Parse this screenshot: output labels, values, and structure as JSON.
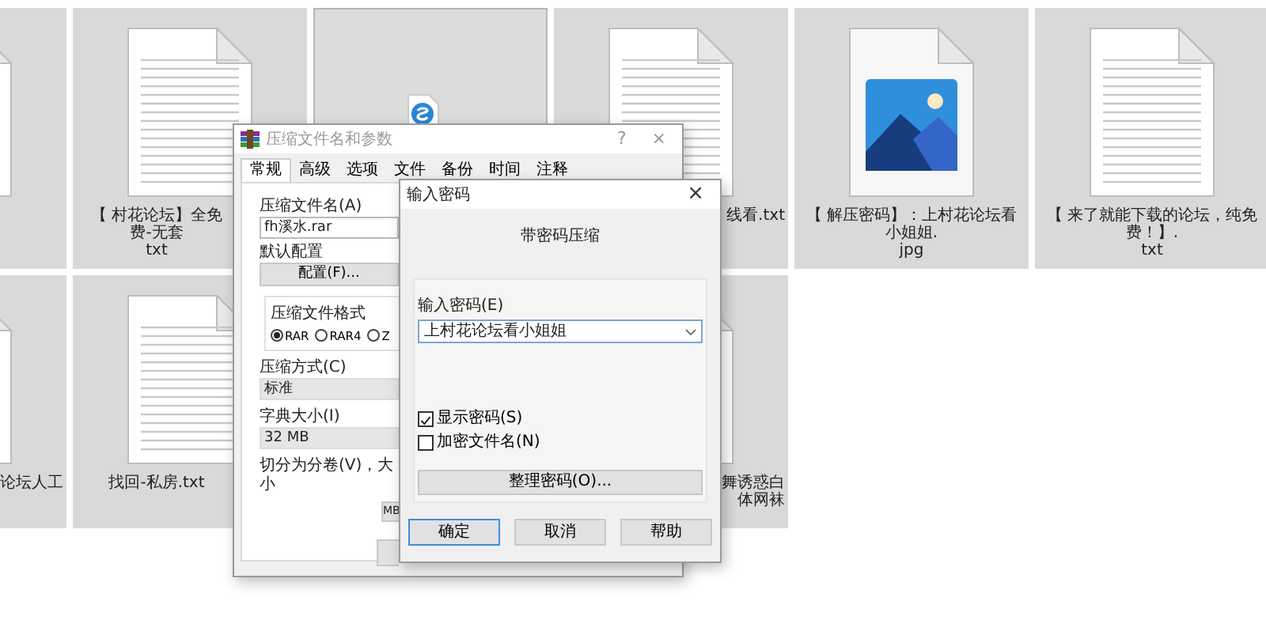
{
  "file_grid": {
    "rows": [
      {
        "tiles": [
          {
            "kind": "text",
            "selected": false
          },
          {
            "kind": "text",
            "selected": false,
            "lines": [
              "【 村花论坛】全免费-无套",
              "txt"
            ]
          },
          {
            "kind": "app",
            "selected": true
          },
          {
            "kind": "text",
            "selected": false,
            "lines": [
              "线看.txt"
            ]
          },
          {
            "kind": "image",
            "selected": false,
            "lines": [
              "【 解压密码】：上村花论坛看小姐姐.",
              "jpg"
            ]
          },
          {
            "kind": "text",
            "selected": false,
            "lines": [
              "【 来了就能下载的论坛，纯免费！】.",
              "txt"
            ]
          }
        ]
      },
      {
        "tiles": [
          {
            "kind": "text",
            "selected": false,
            "lines": [
              "论坛人工"
            ]
          },
          {
            "kind": "text",
            "selected": false,
            "lines": [
              "找回-私房.txt"
            ]
          },
          {
            "kind": "text",
            "selected": false,
            "lines": [
              "舞诱惑白",
              "体网袜"
            ]
          }
        ]
      }
    ]
  },
  "archive_dialog": {
    "title": "压缩文件名和参数",
    "help_button": "?",
    "close_button": "×",
    "tabs": [
      {
        "label": "常规",
        "selected": true
      },
      {
        "label": "高级",
        "selected": false
      },
      {
        "label": "选项",
        "selected": false
      },
      {
        "label": "文件",
        "selected": false
      },
      {
        "label": "备份",
        "selected": false
      },
      {
        "label": "时间",
        "selected": false
      },
      {
        "label": "注释",
        "selected": false
      }
    ],
    "archive_name_label": "压缩文件名(A)",
    "archive_name_value": "fh溪水.rar",
    "profile_label": "默认配置",
    "profile_button": "配置(F)...",
    "format_label": "压缩文件格式",
    "formats": [
      {
        "label": "RAR",
        "selected": true
      },
      {
        "label": "RAR4",
        "selected": false
      },
      {
        "label": "Z",
        "selected": false
      }
    ],
    "method_label": "压缩方式(C)",
    "method_value": "标准",
    "dictionary_label": "字典大小(I)",
    "dictionary_value": "32 MB",
    "split_label": "切分为分卷(V)，大小",
    "split_unit": "MB"
  },
  "password_dialog": {
    "title": "输入密码",
    "close_button": "×",
    "heading": "带密码压缩",
    "password_label": "输入密码(E)",
    "password_value": "上村花论坛看小姐姐",
    "options": [
      {
        "label": "显示密码(S)",
        "checked": true
      },
      {
        "label": "加密文件名(N)",
        "checked": false
      }
    ],
    "organize_button": "整理密码(O)...",
    "buttons": [
      {
        "label": "确定",
        "default": true
      },
      {
        "label": "取消",
        "default": false
      },
      {
        "label": "帮助",
        "default": false
      }
    ]
  }
}
